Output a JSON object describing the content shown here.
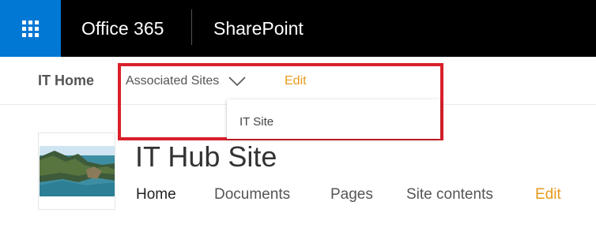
{
  "suite_bar": {
    "brand": "Office 365",
    "app_name": "SharePoint",
    "waffle_icon": "app-launcher-icon",
    "colors": {
      "waffle_bg": "#0078d4",
      "bar_bg": "#000000"
    }
  },
  "hub_nav": {
    "home_label": "IT Home",
    "associated_sites_label": "Associated Sites",
    "edit_label": "Edit",
    "dropdown_items": [
      {
        "label": "IT Site"
      }
    ]
  },
  "site_header": {
    "title": "IT Hub Site",
    "nav": [
      {
        "label": "Home"
      },
      {
        "label": "Documents"
      },
      {
        "label": "Pages"
      },
      {
        "label": "Site contents"
      }
    ],
    "edit_label": "Edit"
  },
  "colors": {
    "accent_edit": "#e69a1c",
    "highlight_box": "#d9202a"
  }
}
